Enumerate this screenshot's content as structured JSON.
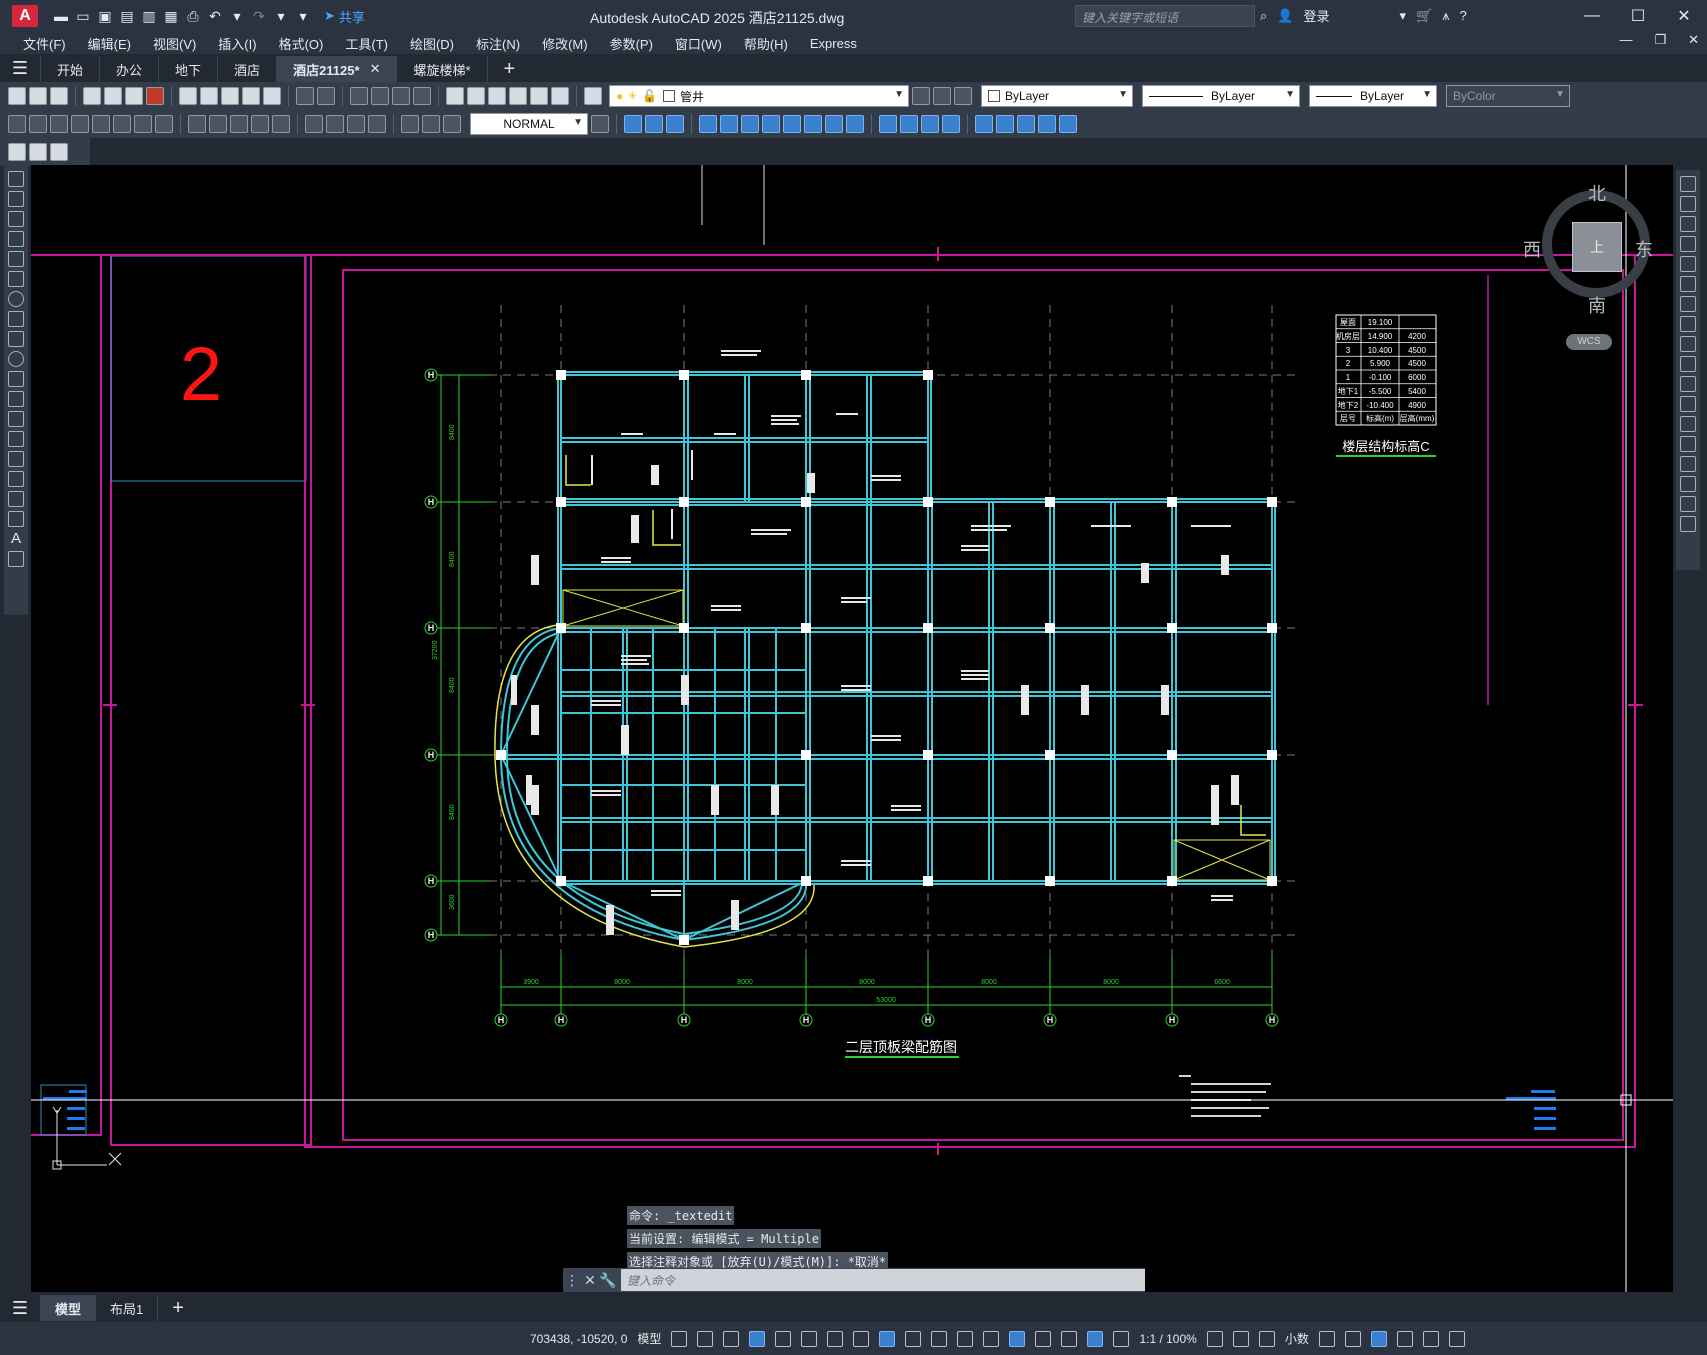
{
  "titlebar": {
    "app_logo": "A",
    "share_label": "共享",
    "title": "Autodesk AutoCAD 2025    酒店21125.dwg",
    "search_placeholder": "键入关键字或短语",
    "login_label": "登录"
  },
  "menu": [
    "文件(F)",
    "编辑(E)",
    "视图(V)",
    "插入(I)",
    "格式(O)",
    "工具(T)",
    "绘图(D)",
    "标注(N)",
    "修改(M)",
    "参数(P)",
    "窗口(W)",
    "帮助(H)",
    "Express"
  ],
  "file_tabs": [
    {
      "label": "开始",
      "active": false
    },
    {
      "label": "办公",
      "active": false
    },
    {
      "label": "地下",
      "active": false
    },
    {
      "label": "酒店",
      "active": false
    },
    {
      "label": "酒店21125*",
      "active": true
    },
    {
      "label": "螺旋楼梯*",
      "active": false
    }
  ],
  "toolbar": {
    "layer_name": "管井",
    "color_combo": "ByLayer",
    "linetype_combo": "ByLayer",
    "lineweight_combo": "ByLayer",
    "plotstyle_combo": "ByColor",
    "dimstyle_combo": "NORMAL"
  },
  "viewcube": {
    "north": "北",
    "south": "南",
    "east": "东",
    "west": "西",
    "face": "上",
    "wcs": "WCS"
  },
  "drawing": {
    "sheet_number": "2",
    "plan_title": "二层顶板梁配筋图",
    "elevation_table_title": "楼层结构标高C",
    "elevation_table": [
      [
        "屋面",
        "19.100",
        ""
      ],
      [
        "机房层",
        "14.900",
        "4200"
      ],
      [
        "3",
        "10.400",
        "4500"
      ],
      [
        "2",
        "5.900",
        "4500"
      ],
      [
        "1",
        "-0.100",
        "6000"
      ],
      [
        "地下1",
        "-5.500",
        "5400"
      ],
      [
        "地下2",
        "-10.400",
        "4900"
      ],
      [
        "层号",
        "标高(m)",
        "层高(mm)"
      ]
    ],
    "grid_left": [
      "H",
      "H",
      "H",
      "H",
      "H",
      "H"
    ],
    "grid_bottom": [
      "H",
      "H",
      "H",
      "H",
      "H",
      "H",
      "H",
      "H"
    ],
    "bottom_dims": [
      "3900",
      "8000",
      "8000",
      "8000",
      "8000",
      "8000",
      "6600"
    ],
    "bottom_total": "53000",
    "left_dims": [
      "8400",
      "8400",
      "8400",
      "8400",
      "3600"
    ],
    "left_total": "37200"
  },
  "command": {
    "history": [
      "命令: _textedit",
      "当前设置: 编辑模式 = Multiple",
      "选择注释对象或 [放弃(U)/模式(M)]: *取消*"
    ],
    "placeholder": "键入命令"
  },
  "layout_tabs": [
    {
      "label": "模型",
      "active": true
    },
    {
      "label": "布局1",
      "active": false
    }
  ],
  "status": {
    "coords": "703438, -10520, 0",
    "model_label": "模型",
    "scale": "1:1 / 100%",
    "units": "小数"
  }
}
